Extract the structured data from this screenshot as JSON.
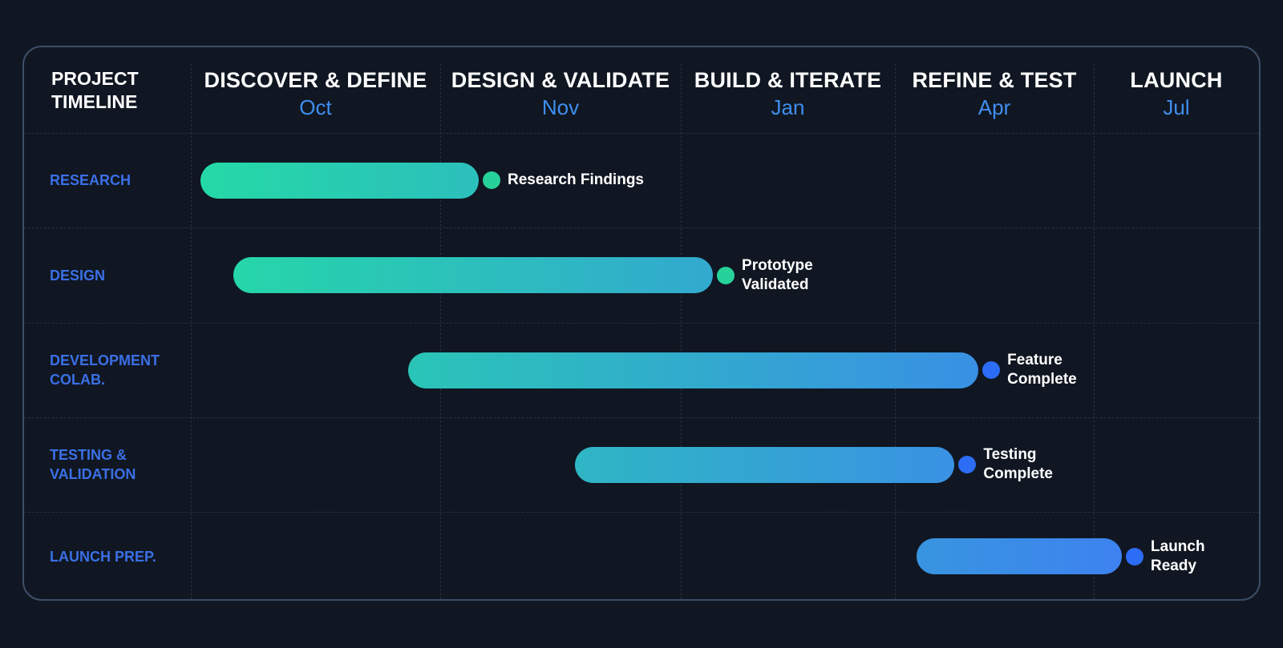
{
  "colors": {
    "background": "#101722",
    "border": "#3e4e68",
    "phase_month": "#3f8ef0",
    "row_label": "#3b6fe6",
    "teal": "#25d9a6",
    "blue": "#3d82f0",
    "dot_teal": "#27d19a",
    "dot_blue": "#2d6cf5"
  },
  "corner_title": [
    "PROJECT",
    "TIMELINE"
  ],
  "chart_data": {
    "type": "gantt",
    "phases": [
      {
        "name": "DISCOVER & DEFINE",
        "month": "Oct"
      },
      {
        "name": "DESIGN & VALIDATE",
        "month": "Nov"
      },
      {
        "name": "BUILD & ITERATE",
        "month": "Jan"
      },
      {
        "name": "REFINE & TEST",
        "month": "Apr"
      },
      {
        "name": "LAUNCH",
        "month": "Jul"
      }
    ],
    "tasks": [
      {
        "label": [
          "RESEARCH"
        ],
        "start": 0.04,
        "end": 1.16,
        "milestone": [
          "Research Findings"
        ],
        "dot": "teal"
      },
      {
        "label": [
          "DESIGN"
        ],
        "start": 0.17,
        "end": 2.15,
        "milestone": [
          "Prototype",
          "Validated"
        ],
        "dot": "teal"
      },
      {
        "label": [
          "DEVELOPMENT",
          "COLAB."
        ],
        "start": 0.87,
        "end": 3.42,
        "milestone": [
          "Feature",
          "Complete"
        ],
        "dot": "blue"
      },
      {
        "label": [
          "TESTING &",
          "VALIDATION"
        ],
        "start": 1.56,
        "end": 3.3,
        "milestone": [
          "Testing",
          "Complete"
        ],
        "dot": "blue"
      },
      {
        "label": [
          "LAUNCH PREP."
        ],
        "start": 3.11,
        "end": 4.17,
        "milestone": [
          "Launch",
          "Ready"
        ],
        "dot": "blue"
      }
    ]
  }
}
